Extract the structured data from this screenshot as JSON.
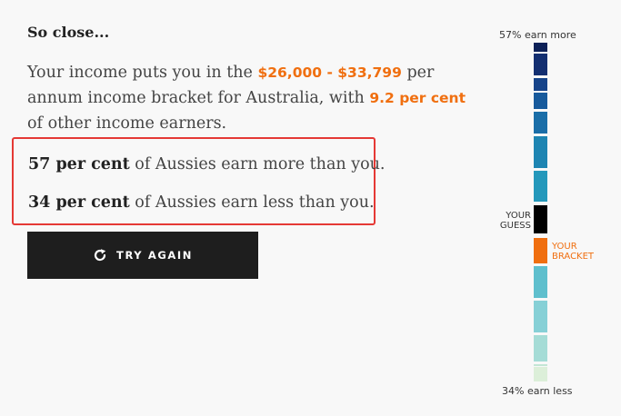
{
  "result": {
    "heading": "So close...",
    "summary": {
      "before": "Your income puts you in the ",
      "bracket": "$26,000 - $33,799",
      "middle": " per annum income bracket for Australia, with ",
      "share": "9.2 per cent",
      "after": " of other income earners."
    },
    "stats": [
      {
        "bold": "57 per cent",
        "rest": " of Aussies earn more than you."
      },
      {
        "bold": "34 per cent",
        "rest": " of Aussies earn less than you."
      }
    ],
    "try_again_label": "TRY AGAIN"
  },
  "distribution_bar": {
    "top_label": "57% earn more",
    "bottom_label": "34% earn less",
    "guess_label_line1": "YOUR",
    "guess_label_line2": "GUESS",
    "bracket_label_line1": "YOUR",
    "bracket_label_line2": "BRACKET",
    "colors": {
      "accent": "#f06f10",
      "guess": "#000000",
      "box_border": "#e53935",
      "button": "#1e1e1e"
    },
    "segments": [
      {
        "color": "#0d2158"
      },
      {
        "color": "#132f71"
      },
      {
        "color": "#16448a"
      },
      {
        "color": "#175a9c"
      },
      {
        "color": "#1a6ea8"
      },
      {
        "color": "#1e85b2"
      },
      {
        "color": "#2498bb"
      },
      {
        "color": "#000000",
        "role": "guess"
      },
      {
        "color": "#f06f10",
        "role": "bracket"
      },
      {
        "color": "#5fbfcd"
      },
      {
        "color": "#86d0d6"
      },
      {
        "color": "#a5dcd6"
      },
      {
        "color": "#c3e6d5"
      },
      {
        "color": "#dcefd9"
      }
    ]
  }
}
